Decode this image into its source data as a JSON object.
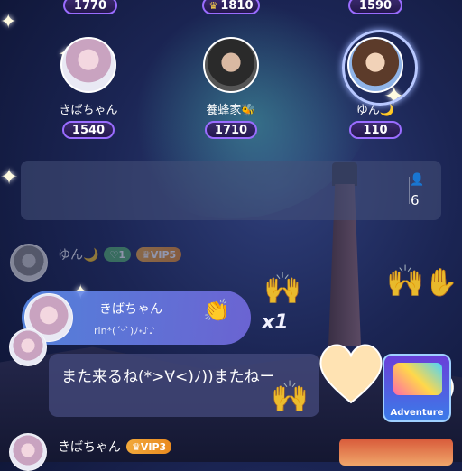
{
  "top_row": [
    {
      "score": "1770",
      "crown": false
    },
    {
      "score": "1810",
      "crown": true
    },
    {
      "score": "1590",
      "crown": false
    }
  ],
  "seats": [
    {
      "name": "きばちゃん",
      "score": "1540"
    },
    {
      "name": "養蜂家🐝",
      "score": "1710"
    },
    {
      "name": "ゆん🌙",
      "score": "110"
    }
  ],
  "room_info": {
    "viewer_count": "6"
  },
  "chat": {
    "faded_user": {
      "name": "ゆん🌙",
      "level": "1",
      "vip": "VIP5"
    },
    "gift": {
      "name": "きばちゃん",
      "subtext": "rin*(ˊᵕˋ)ﾉ˖♪♪",
      "count": "x1"
    },
    "message": {
      "text": "また来るね(*>∀<)ﾉ))またねー"
    },
    "last_user": {
      "name": "きばちゃん",
      "vip": "VIP3"
    }
  },
  "game_banner": {
    "label": "Adventure"
  },
  "colors": {
    "accent": "#9a6cff",
    "vip": "#f2a93b",
    "gift_bubble": "#5a8ceb"
  }
}
